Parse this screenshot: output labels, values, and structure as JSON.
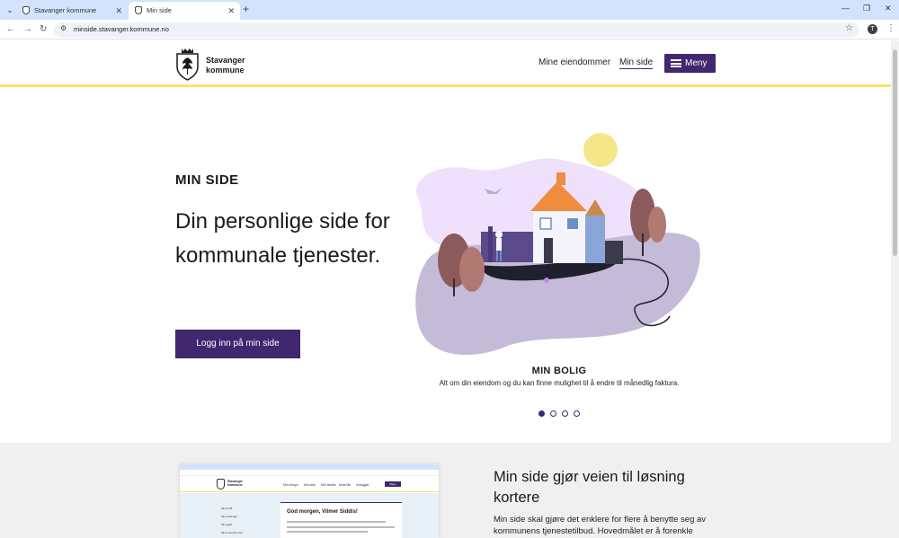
{
  "browser": {
    "tabs": [
      {
        "title": "Stavanger kommune"
      },
      {
        "title": "Min side"
      }
    ],
    "url": "minside.stavanger.kommune.no",
    "profile_initial": "T"
  },
  "header": {
    "logo_line1": "Stavanger",
    "logo_line2": "kommune",
    "nav": {
      "eiendommer": "Mine eiendommer",
      "minside": "Min side"
    },
    "menu_label": "Meny"
  },
  "hero": {
    "eyebrow": "MIN SIDE",
    "title": "Din personlige side for kommunale tjenester.",
    "login_label": "Logg inn på min side"
  },
  "carousel": {
    "slide_title": "MIN BOLIG",
    "slide_text": "Alt om din eiendom og du kan finne mulighet til å endre til månedlig faktura.",
    "slide_count": 4,
    "active_index": 0
  },
  "lower": {
    "title": "Min side gjør veien til løsning kortere",
    "text": "Min side skal gjøre det enklere for flere å benytte seg av kommunens tjenestetilbud. Hovedmålet er å forenkle",
    "preview": {
      "logo_line1": "Stavanger",
      "logo_line2": "kommune",
      "nav1": "Min innsyn",
      "nav2": "Min side",
      "nav3": "Min familie",
      "nav4": "Mine lån",
      "nav5": "Innlogget",
      "menu": "Meny",
      "greeting": "God morgen, Vilmer Siddis!",
      "side1": "Min profil",
      "side2": "Mine betinger",
      "side3": "Min gjeld",
      "side4": "Mine eiendommer"
    }
  },
  "colors": {
    "brand_purple": "#40276f",
    "accent_yellow": "#f5e56b"
  }
}
